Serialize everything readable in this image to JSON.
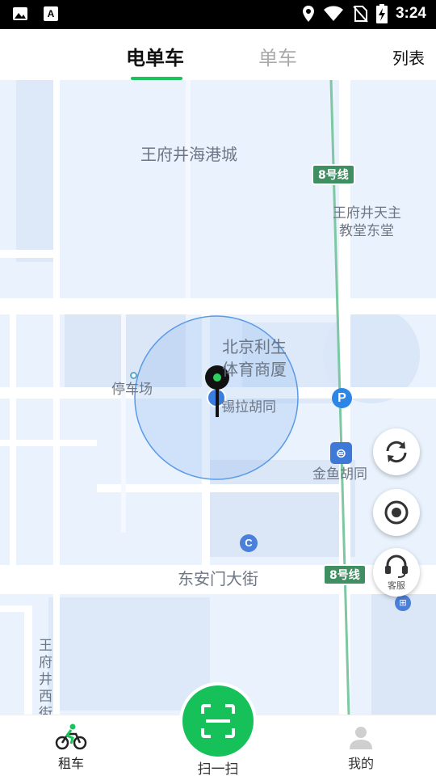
{
  "status_bar": {
    "time": "3:24",
    "icons": [
      "image-icon",
      "font-icon",
      "location-icon",
      "wifi-icon",
      "no-sim-icon",
      "battery-charging-icon"
    ]
  },
  "header": {
    "tabs": [
      {
        "label": "电单车",
        "active": true
      },
      {
        "label": "单车",
        "active": false
      }
    ],
    "list_label": "列表",
    "accent_color": "#1bc35c"
  },
  "map": {
    "labels": {
      "mall": "王府井海港城",
      "church_line1": "王府井天主",
      "church_line2": "教堂东堂",
      "building_line1": "北京利生",
      "building_line2": "体育商厦",
      "parking": "停车场",
      "hutong1": "锡拉胡同",
      "hutong2": "金鱼胡同",
      "street": "东安门大街",
      "west_street": "王府井西街"
    },
    "metro": {
      "line_label": "8号线"
    },
    "parking_marker": "P",
    "c_marker": "C"
  },
  "side_buttons": {
    "refresh_icon": "refresh-icon",
    "locate_icon": "locate-icon",
    "service_label": "客服"
  },
  "bottom_nav": {
    "rent_label": "租车",
    "scan_label": "扫一扫",
    "mine_label": "我的"
  }
}
